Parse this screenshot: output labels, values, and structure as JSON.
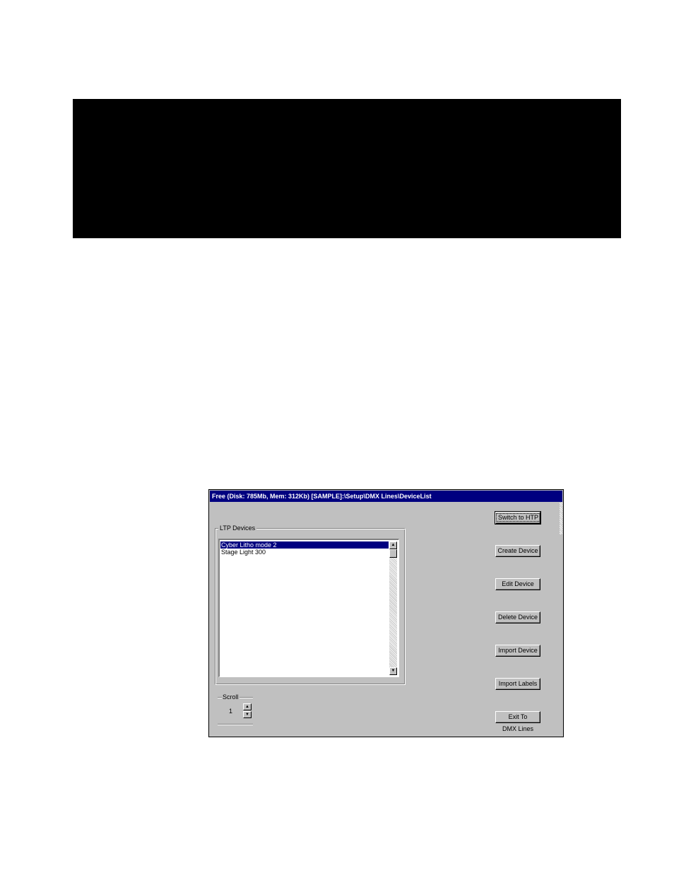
{
  "titlebar": {
    "text": "Free (Disk: 785Mb, Mem: 312Kb)    [SAMPLE]:\\Setup\\DMX Lines\\DeviceList"
  },
  "ltp_group": {
    "label": "LTP Devices",
    "items": [
      {
        "label": "Cyber Litho mode 2",
        "selected": true
      },
      {
        "label": "Stage Light 300",
        "selected": false
      }
    ]
  },
  "scroll_group": {
    "label": "Scroll",
    "value": "1"
  },
  "buttons": {
    "switch_to_htp": "Switch to HTP",
    "create_device": "Create Device",
    "edit_device": "Edit Device",
    "delete_device": "Delete Device",
    "import_device": "Import Device",
    "import_labels": "Import Labels",
    "exit_to": "Exit To",
    "exit_to_caption": "DMX Lines"
  },
  "colors": {
    "titlebar_bg": "#000080",
    "window_bg": "#c0c0c0",
    "selection_bg": "#000080"
  }
}
